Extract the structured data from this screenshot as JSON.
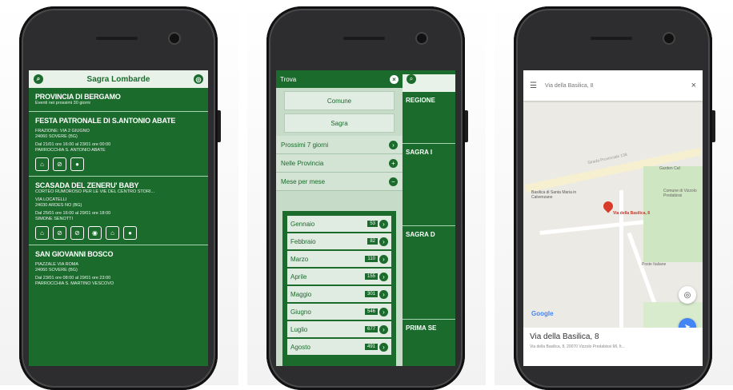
{
  "screen1": {
    "header_title": "Sagra Lombarde",
    "province": "PROVINCIA DI BERGAMO",
    "province_sub": "Eventi nei prossimi 30 giorni",
    "events": [
      {
        "title": "FESTA PATRONALE DI S.ANTONIO ABATE",
        "lines": [
          "FRAZIONE: VIA 2 GIUGNO",
          "24060 SOVERE (BG)",
          "Dal 21/01 ore 16:00 al 23/01 ore 00:00",
          "PARROCCHIA S. ANTONIO ABATE"
        ],
        "icons": [
          "party-icon",
          "no-icon",
          "pin-icon"
        ]
      },
      {
        "title": "SCASADA DEL ZENERU' BABY",
        "lines": [
          "CORTEO RUMOROSO PER LE VIE DEL CENTRO STORI...",
          "VIA LOCATELLI",
          "24030 ARDES NO (BG)",
          "Dal 25/01 ore 16:00 al 29/01 ore 18:00",
          "SIMONE SENOTTI"
        ],
        "icons": [
          "party-icon",
          "no-icon",
          "no-icon",
          "food-icon",
          "home-icon",
          "pin-icon"
        ]
      },
      {
        "title": "SAN GIOVANNI BOSCO",
        "lines": [
          "PIAZZALE VIA ROMA",
          "24060 SOVERE (BG)",
          "Dal 23/01 ore 08:00 al 29/01 ore 23:00",
          "PARROCCHIA S. MARTINO VESCOVO"
        ],
        "icons": []
      }
    ]
  },
  "screen2": {
    "search_label": "Trova",
    "btn_comune": "Comune",
    "btn_sagra": "Sagra",
    "acc": [
      {
        "label": "Prossimi 7 giorni",
        "icon": "›"
      },
      {
        "label": "Nelle Provincia",
        "icon": "+"
      },
      {
        "label": "Mese per mese",
        "icon": "−"
      }
    ],
    "months": [
      {
        "name": "Gennaio",
        "count": "53"
      },
      {
        "name": "Febbraio",
        "count": "82"
      },
      {
        "name": "Marzo",
        "count": "110"
      },
      {
        "name": "Aprile",
        "count": "155"
      },
      {
        "name": "Maggio",
        "count": "301"
      },
      {
        "name": "Giugno",
        "count": "546"
      },
      {
        "name": "Luglio",
        "count": "677"
      },
      {
        "name": "Agosto",
        "count": "491"
      }
    ],
    "peek": [
      "REGIONE",
      "SAGRA I",
      "SAGRA D",
      "PRIMA SE"
    ]
  },
  "screen3": {
    "search_value": "Via della Basilica, 8",
    "map_label_road": "Strada Provinciale 138",
    "place1": "Basilica di Santa Maria in Calvenzano",
    "place2": "Via della Basilica, 8",
    "place3": "Poste Italiane",
    "place4": "Garden Caf",
    "place5": "Comune di Vizzolo Predabissi",
    "logo": "Google",
    "card_title": "Via della Basilica, 8",
    "card_sub": "Via della Basilica, 8, 20070 Vizzolo Predabissi MI, It..."
  }
}
